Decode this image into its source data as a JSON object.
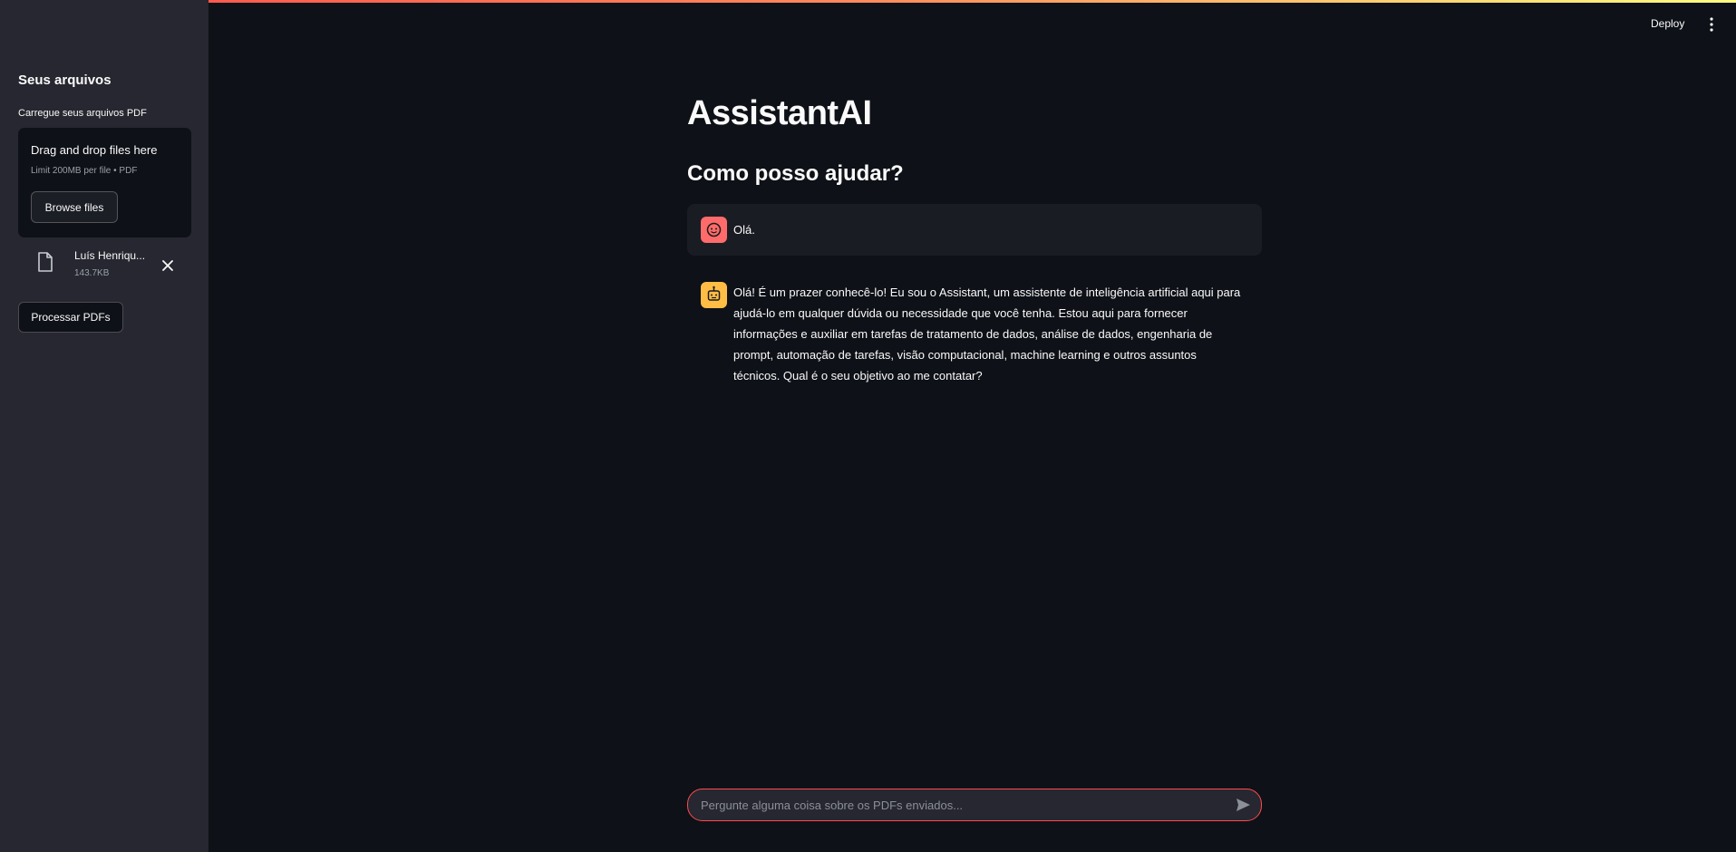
{
  "header": {
    "deploy_label": "Deploy",
    "menu_icon": "vertical-ellipsis-icon"
  },
  "sidebar": {
    "title": "Seus arquivos",
    "uploader": {
      "label": "Carregue seus arquivos PDF",
      "dropzone_title": "Drag and drop files here",
      "dropzone_limit": "Limit 200MB per file • PDF",
      "browse_label": "Browse files"
    },
    "files": [
      {
        "name": "Luís Henriqu...",
        "size": "143.7KB",
        "icon": "file-icon"
      }
    ],
    "process_label": "Processar PDFs"
  },
  "main": {
    "title": "AssistantAI",
    "subtitle": "Como posso ajudar?",
    "messages": [
      {
        "role": "user",
        "avatar": "user-face-icon",
        "avatar_color": "#ff6b6b",
        "text": "Olá."
      },
      {
        "role": "assistant",
        "avatar": "robot-icon",
        "avatar_color": "#ffbd45",
        "text": "Olá! É um prazer conhecê-lo! Eu sou o Assistant, um assistente de inteligência artificial aqui para ajudá-lo em qualquer dúvida ou necessidade que você tenha. Estou aqui para fornecer informações e auxiliar em tarefas de tratamento de dados, análise de dados, engenharia de prompt, automação de tarefas, visão computacional, machine learning e outros assuntos técnicos. Qual é o seu objetivo ao me contatar?"
      }
    ],
    "chat_input": {
      "value": "",
      "placeholder": "Pergunte alguma coisa sobre os PDFs enviados...",
      "send_icon": "send-icon"
    }
  },
  "colors": {
    "background": "#0e1117",
    "sidebar": "#262730",
    "accent": "#ff4b4b",
    "text": "#fafafa"
  }
}
